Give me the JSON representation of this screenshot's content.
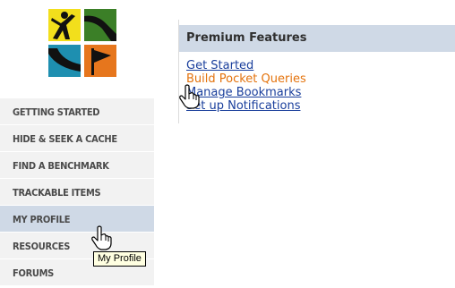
{
  "sidebar": {
    "items": [
      {
        "label": "GETTING STARTED"
      },
      {
        "label": "HIDE & SEEK A CACHE"
      },
      {
        "label": "FIND A BENCHMARK"
      },
      {
        "label": "TRACKABLE ITEMS"
      },
      {
        "label": "MY PROFILE",
        "active": true
      },
      {
        "label": "RESOURCES"
      },
      {
        "label": "FORUMS"
      }
    ]
  },
  "premium": {
    "title": "Premium Features",
    "links": [
      {
        "label": "Get Started"
      },
      {
        "label": "Build Pocket Queries",
        "visited": true
      },
      {
        "label": "Manage Bookmarks"
      },
      {
        "label": "Set up Notifications"
      }
    ]
  },
  "tooltip": "My Profile",
  "colors": {
    "logo_yellow": "#f2df1c",
    "logo_green": "#3b7f27",
    "logo_blue": "#1e8fb0",
    "logo_orange": "#e6761d",
    "nav_active": "#cfd9e6",
    "link": "#1a3f9c",
    "link_visited": "#e4730d"
  },
  "icons": [
    "logo-hiker-icon",
    "logo-path-icon",
    "logo-trail-icon",
    "logo-flag-icon",
    "hand-cursor-icon"
  ]
}
